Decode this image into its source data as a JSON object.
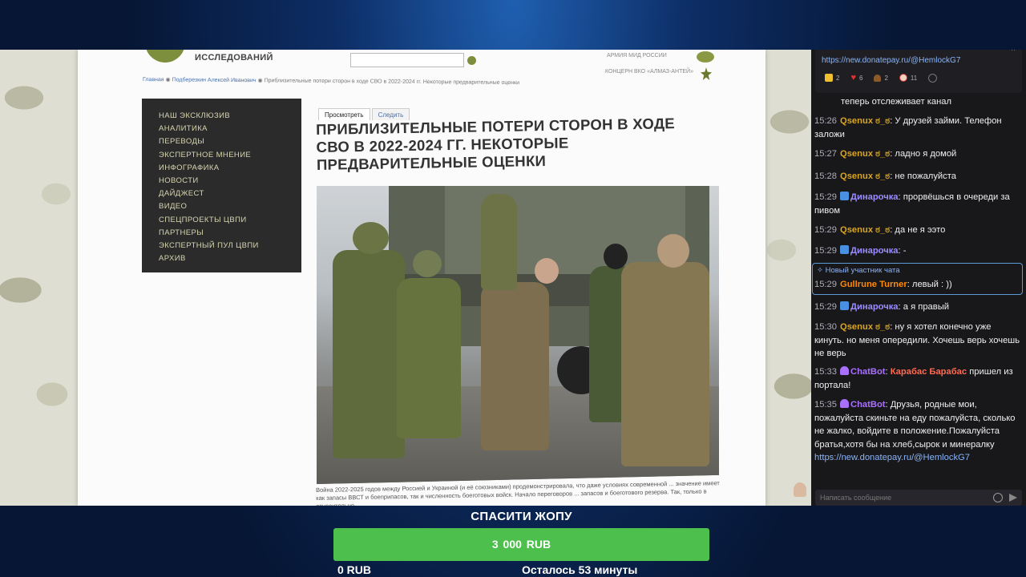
{
  "website": {
    "org_name": "ИССЛЕДОВАНИЙ",
    "header_links": [
      "АРМИЯ МИД РОССИИ",
      "КОНЦЕРН ВКО «АЛМАЗ-АНТЕЙ»"
    ],
    "breadcrumb": {
      "home": "Главная",
      "author": "Подберезкин Алексей Иванович",
      "current": "Приблизительные потери сторон в ходе СВО в 2022-2024 гг. Некоторые предварительные оценки"
    },
    "menu": [
      "НАШ ЭКСКЛЮЗИВ",
      "АНАЛИТИКА",
      "ПЕРЕВОДЫ",
      "ЭКСПЕРТНОЕ МНЕНИЕ",
      "ИНФОГРАФИКА",
      "НОВОСТИ",
      "ДАЙДЖЕСТ",
      "ВИДЕО",
      "СПЕЦПРОЕКТЫ ЦВПИ",
      "ПАРТНЕРЫ",
      "ЭКСПЕРТНЫЙ ПУЛ ЦВПИ",
      "АРХИВ"
    ],
    "tabs": {
      "view": "Просмотреть",
      "edit": "Следить"
    },
    "article_title": "ПРИБЛИЗИТЕЛЬНЫЕ ПОТЕРИ СТОРОН В ХОДЕ СВО В 2022-2024 ГГ. НЕКОТОРЫЕ ПРЕДВАРИТЕЛЬНЫЕ ОЦЕНКИ",
    "article_excerpt": "Война 2022-2025 годов между Россией и Украиной (и её союзниками) продемонстрировала, что даже условиях современной ... значение имеет как запасы ВВСТ и боеприпасов, так и численность боеготовых войск. Начало переговоров ... запасов и боеготового резерва. Так, только в относительно ..."
  },
  "chat": {
    "pinned": {
      "link": "https://new.donatepay.ru/@HemlockG7",
      "reactions": [
        {
          "icon": "thumbs-up",
          "count": "2"
        },
        {
          "icon": "heart",
          "count": "6"
        },
        {
          "icon": "poop",
          "count": "2"
        },
        {
          "icon": "monkey",
          "count": "11"
        }
      ]
    },
    "partial_line": "теперь отслеживает канал",
    "messages": [
      {
        "time": "15:26",
        "user": "Qsenux ಠ_ಠ",
        "text": ": У друзей займи. Телефон заложи"
      },
      {
        "time": "15:27",
        "user": "Qsenux ಠ_ಠ",
        "text": ": ладно я домой"
      },
      {
        "time": "15:28",
        "user": "Qsenux ಠ_ಠ",
        "text": ": не пожалуйста"
      },
      {
        "time": "15:29",
        "user": "Динарочка",
        "text": ": прорвёшься в очереди за пивом"
      },
      {
        "time": "15:29",
        "user": "Qsenux ಠ_ಠ",
        "text": ": да не я ээто"
      },
      {
        "time": "15:29",
        "user": "Динарочка",
        "text": ": -"
      },
      {
        "time": "15:29",
        "user": "Gullrune Turner",
        "text": ": левый : ))"
      },
      {
        "time": "15:29",
        "user": "Динарочка",
        "text": ": а я правый"
      },
      {
        "time": "15:30",
        "user": "Qsenux ಠ_ಠ",
        "text": ": ну я хотел конечно уже кинуть. но меня опередили. Хочешь верь хочешь не верь"
      },
      {
        "time": "15:33",
        "user": "ChatBot",
        "text": ":",
        "mention": "Карабас Барабас",
        "text2": " пришел из портала!"
      },
      {
        "time": "15:35",
        "user": "ChatBot",
        "text": ":  Друзья, родные мои, пожалуйста скиньте на еду пожалуйста, сколько не жалко, войдите в положение.Пожалуйста братья,хотя бы на хлеб,сырок и минералку",
        "link": "https://new.donatepay.ru/@HemlockG7"
      }
    ],
    "new_member_label": "Новый участник чата",
    "input_placeholder": "Написать сообщение"
  },
  "donation": {
    "goal_title": "СПАСИТИ ЖОПУ",
    "goal_amount": "3 000 RUB",
    "raised": "0 RUB",
    "progress_fraction": 0,
    "time_left": "Осталось 53 минуты",
    "bar_color": "#4cbf4c"
  }
}
